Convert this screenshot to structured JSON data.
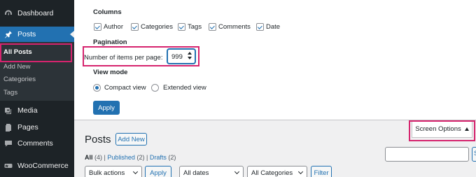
{
  "sidebar": {
    "items": [
      {
        "label": "Dashboard",
        "icon": "dashboard-icon"
      },
      {
        "label": "Posts",
        "icon": "pushpin-icon"
      },
      {
        "label": "Media",
        "icon": "media-icon"
      },
      {
        "label": "Pages",
        "icon": "pages-icon"
      },
      {
        "label": "Comments",
        "icon": "comments-icon"
      },
      {
        "label": "WooCommerce",
        "icon": "woocommerce-icon"
      }
    ],
    "submenu": [
      "All Posts",
      "Add New",
      "Categories",
      "Tags"
    ]
  },
  "screen_options": {
    "columns_heading": "Columns",
    "columns": [
      "Author",
      "Categories",
      "Tags",
      "Comments",
      "Date"
    ],
    "pagination_heading": "Pagination",
    "items_per_page_label": "Number of items per page:",
    "items_per_page_value": "999",
    "view_mode_heading": "View mode",
    "view_modes": [
      "Compact view",
      "Extended view"
    ],
    "view_mode_selected": "Compact view",
    "apply_label": "Apply",
    "toggle_label": "Screen Options"
  },
  "posts": {
    "title": "Posts",
    "add_new_label": "Add New",
    "filters": {
      "all_label": "All",
      "all_count": "(4)",
      "separator": "|",
      "published_label": "Published",
      "published_count": "(2)",
      "drafts_label": "Drafts",
      "drafts_count": "(2)"
    },
    "search_button_label": "S",
    "bulk_actions_label": "Bulk actions",
    "bulk_apply_label": "Apply",
    "dates_label": "All dates",
    "categories_label": "All Categories",
    "filter_label": "Filter"
  },
  "colors": {
    "sidebar_bg": "#1d2327",
    "accent": "#2271b1",
    "highlight_border": "#d6246e"
  }
}
